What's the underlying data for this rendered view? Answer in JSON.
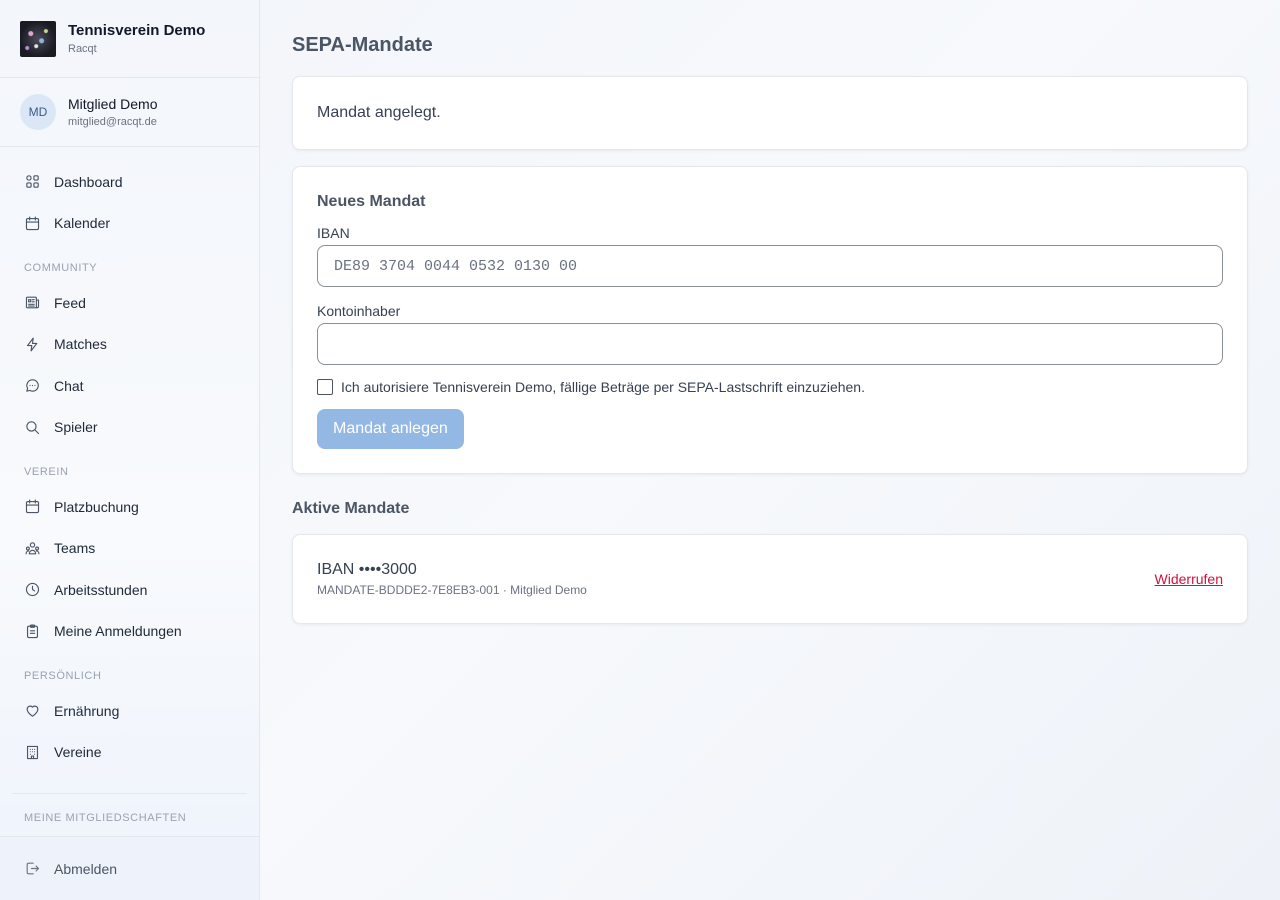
{
  "brand": {
    "title": "Tennisverein Demo",
    "subtitle": "Racqt"
  },
  "user": {
    "initials": "MD",
    "name": "Mitglied Demo",
    "email": "mitglied@racqt.de"
  },
  "nav": {
    "top": [
      {
        "label": "Dashboard",
        "icon": "grid-icon"
      },
      {
        "label": "Kalender",
        "icon": "calendar-icon"
      }
    ],
    "community_label": "Community",
    "community": [
      {
        "label": "Feed",
        "icon": "newspaper-icon"
      },
      {
        "label": "Matches",
        "icon": "lightning-icon"
      },
      {
        "label": "Chat",
        "icon": "chat-bubble-icon"
      },
      {
        "label": "Spieler",
        "icon": "search-icon"
      }
    ],
    "verein_label": "Verein",
    "verein": [
      {
        "label": "Platzbuchung",
        "icon": "calendar-icon"
      },
      {
        "label": "Teams",
        "icon": "team-icon"
      },
      {
        "label": "Arbeitsstunden",
        "icon": "clock-icon"
      },
      {
        "label": "Meine Anmeldungen",
        "icon": "clipboard-icon"
      }
    ],
    "persoenlich_label": "Persönlich",
    "persoenlich": [
      {
        "label": "Ernährung",
        "icon": "heart-icon"
      },
      {
        "label": "Vereine",
        "icon": "building-icon"
      }
    ],
    "memberships_label": "Meine Mitgliedschaften",
    "logout": "Abmelden"
  },
  "page": {
    "title": "SEPA-Mandate",
    "notice": "Mandat angelegt.",
    "form": {
      "title": "Neues Mandat",
      "iban_label": "IBAN",
      "iban_placeholder": "DE89 3704 0044 0532 0130 00",
      "iban_value": "",
      "holder_label": "Kontoinhaber",
      "holder_value": "",
      "consent": "Ich autorisiere Tennisverein Demo, fällige Beträge per SEPA-Lastschrift einzuziehen.",
      "consent_checked": false,
      "submit": "Mandat anlegen"
    },
    "active_title": "Aktive Mandate",
    "mandates": [
      {
        "iban": "IBAN ••••3000",
        "meta": "MANDATE-BDDDE2-7E8EB3-001 · Mitglied Demo",
        "action": "Widerrufen"
      }
    ]
  },
  "colors": {
    "accent_disabled": "#93b8e3",
    "danger": "#d0123e"
  }
}
